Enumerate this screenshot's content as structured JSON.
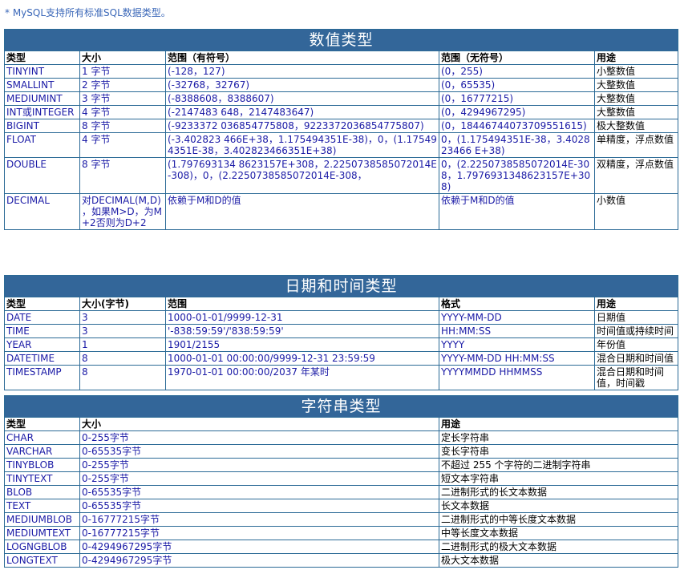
{
  "note": "* MySQL支持所有标准SQL数据类型。",
  "numeric": {
    "title": "数值类型",
    "headers": [
      "类型",
      "大小",
      "范围（有符号）",
      "范围（无符号）",
      "用途"
    ],
    "rows": [
      [
        "TINYINT",
        "1 字节",
        "(-128，127)",
        "(0，255)",
        "小整数值"
      ],
      [
        "SMALLINT",
        "2 字节",
        "(-32768，32767)",
        "(0，65535)",
        "大整数值"
      ],
      [
        "MEDIUMINT",
        "3 字节",
        "(-8388608，8388607)",
        "(0，16777215)",
        "大整数值"
      ],
      [
        "INT或INTEGER",
        "4 字节",
        "(-2147483 648，2147483647)",
        "(0，4294967295)",
        "大整数值"
      ],
      [
        "BIGINT",
        "8 字节",
        "(-9233372 036854775808，9223372036854775807)",
        "(0，18446744073709551615)",
        "极大整数值"
      ],
      [
        "FLOAT",
        "4 字节",
        "(-3.402823 466E+38，1.175494351E-38)，0，(1.175494351E-38，3.402823466351E+38)",
        "0，(1.175494351E-38，3.402823466 E+38)",
        "单精度，浮点数值"
      ],
      [
        "DOUBLE",
        "8 字节",
        "(1.797693134 8623157E+308，2.2250738585072014E-308)，0，(2.2250738585072014E-308，",
        "0，(2.2250738585072014E-308，1.7976931348623157E+308)",
        "双精度，浮点数值"
      ],
      [
        "DECIMAL",
        "对DECIMAL(M,D) ，如果M>D，为M+2否则为D+2",
        "依赖于M和D的值",
        "依赖于M和D的值",
        "小数值"
      ]
    ]
  },
  "datetime": {
    "title": "日期和时间类型",
    "headers": [
      "类型",
      "大小(字节)",
      "范围",
      "格式",
      "用途"
    ],
    "rows": [
      [
        "DATE",
        "3",
        "1000-01-01/9999-12-31",
        "YYYY-MM-DD",
        "日期值"
      ],
      [
        "TIME",
        "3",
        "'-838:59:59'/'838:59:59'",
        "HH:MM:SS",
        "时间值或持续时间"
      ],
      [
        "YEAR",
        "1",
        "1901/2155",
        "YYYY",
        "年份值"
      ],
      [
        "DATETIME",
        "8",
        "1000-01-01 00:00:00/9999-12-31 23:59:59",
        "YYYY-MM-DD HH:MM:SS",
        "混合日期和时间值"
      ],
      [
        "TIMESTAMP",
        "8",
        "1970-01-01 00:00:00/2037 年某时",
        "YYYYMMDD HHMMSS",
        "混合日期和时间值，时间戳"
      ]
    ]
  },
  "string": {
    "title": "字符串类型",
    "headers": [
      "类型",
      "大小",
      "用途"
    ],
    "rows": [
      [
        "CHAR",
        "0-255字节",
        "定长字符串"
      ],
      [
        "VARCHAR",
        "0-65535字节",
        "变长字符串"
      ],
      [
        "TINYBLOB",
        "0-255字节",
        "不超过 255 个字符的二进制字符串"
      ],
      [
        "TINYTEXT",
        "0-255字节",
        "短文本字符串"
      ],
      [
        "BLOB",
        "0-65535字节",
        "二进制形式的长文本数据"
      ],
      [
        "TEXT",
        "0-65535字节",
        "长文本数据"
      ],
      [
        "MEDIUMBLOB",
        "0-16777215字节",
        "二进制形式的中等长度文本数据"
      ],
      [
        "MEDIUMTEXT",
        "0-16777215字节",
        "中等长度文本数据"
      ],
      [
        "LOGNGBLOB",
        "0-4294967295字节",
        "二进制形式的极大文本数据"
      ],
      [
        "LONGTEXT",
        "0-4294967295字节",
        "极大文本数据"
      ]
    ]
  }
}
